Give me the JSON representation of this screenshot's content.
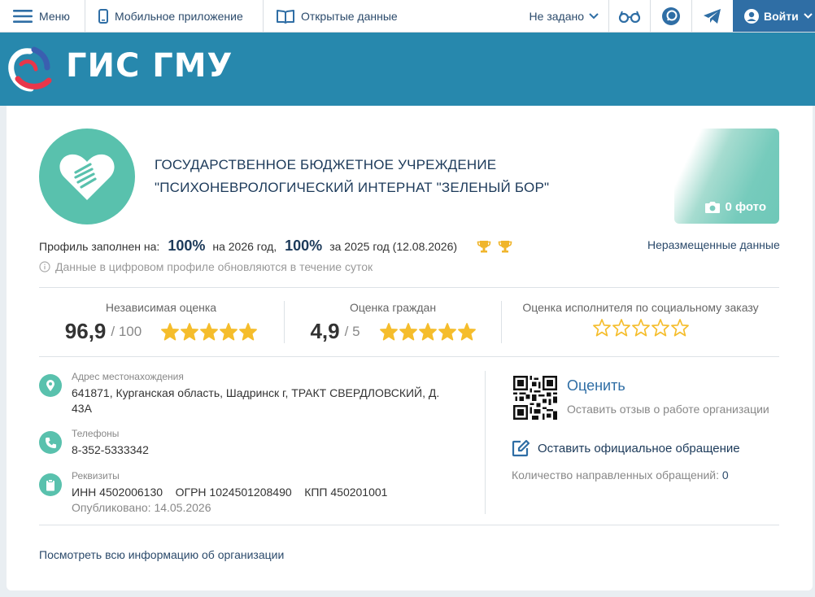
{
  "topbar": {
    "menu_label": "Меню",
    "mobile_label": "Мобильное приложение",
    "opendata_label": "Открытые данные",
    "region_label": "Не задано",
    "login_label": "Войти"
  },
  "brand": {
    "logo_text": "ГИС ГМУ"
  },
  "org": {
    "name_line1": "ГОСУДАРСТВЕННОЕ БЮДЖЕТНОЕ УЧРЕЖДЕНИЕ",
    "name_line2": "\"ПСИХОНЕВРОЛОГИЧЕСКИЙ ИНТЕРНАТ \"ЗЕЛЕНЫЙ БОР\"",
    "photo_label": "0 фото"
  },
  "profile": {
    "label": "Профиль заполнен на:",
    "pct_current": "100%",
    "year_current": "на 2026 год,",
    "pct_prev": "100%",
    "year_prev": "за 2025 год (12.08.2026)",
    "unplaced_link": "Неразмещенные данные",
    "notice": "Данные в цифровом профиле обновляются в течение суток"
  },
  "ratings": {
    "independent": {
      "title": "Независимая оценка",
      "value": "96,9",
      "of": "/ 100",
      "stars": 5
    },
    "citizens": {
      "title": "Оценка граждан",
      "value": "4,9",
      "of": "/ 5",
      "stars": 5
    },
    "social_order": {
      "title": "Оценка исполнителя по социальному заказу",
      "stars": 0
    }
  },
  "info": {
    "address_label": "Адрес местонахождения",
    "address_value": "641871, Курганская область, Шадринск г, ТРАКТ СВЕРДЛОВСКИЙ, Д. 43А",
    "phones_label": "Телефоны",
    "phones_value": "8-352-5333342",
    "requisites_label": "Реквизиты",
    "inn": "ИНН 4502006130",
    "ogrn": "ОГРН 1024501208490",
    "kpp": "КПП 450201001",
    "published": "Опубликовано: 14.05.2026"
  },
  "actions": {
    "rate_link": "Оценить",
    "rate_sub": "Оставить отзыв о работе организации",
    "appeal_link": "Оставить официальное обращение",
    "appeal_count_label": "Количество направленных обращений:",
    "appeal_count": "0",
    "all_info_link": "Посмотреть всю информацию об организации"
  },
  "colors": {
    "banner": "#2788ad",
    "accent_teal": "#59c1ad",
    "star_gold": "#f5bd2c",
    "dark_blue": "#1c3a5a",
    "login_bg": "#2f6ea5"
  }
}
